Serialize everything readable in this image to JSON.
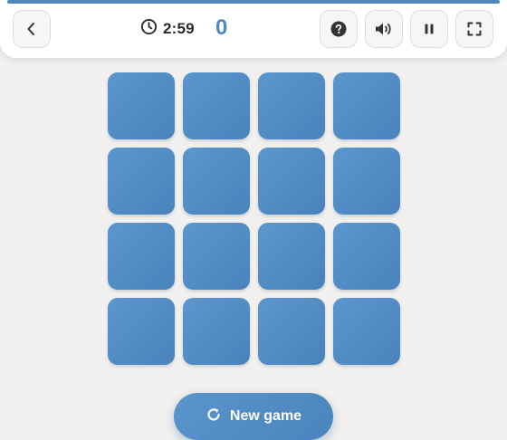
{
  "header": {
    "timer": "2:59",
    "score": "0"
  },
  "board": {
    "rows": 4,
    "columns": 4,
    "cards": [
      {
        "state": "face-down"
      },
      {
        "state": "face-down"
      },
      {
        "state": "face-down"
      },
      {
        "state": "face-down"
      },
      {
        "state": "face-down"
      },
      {
        "state": "face-down"
      },
      {
        "state": "face-down"
      },
      {
        "state": "face-down"
      },
      {
        "state": "face-down"
      },
      {
        "state": "face-down"
      },
      {
        "state": "face-down"
      },
      {
        "state": "face-down"
      },
      {
        "state": "face-down"
      },
      {
        "state": "face-down"
      },
      {
        "state": "face-down"
      },
      {
        "state": "face-down"
      }
    ]
  },
  "actions": {
    "new_game_label": "New game"
  },
  "icons": {
    "back": "chevron-left-icon",
    "timer": "clock-icon",
    "help": "help-icon",
    "sound": "volume-icon",
    "pause": "pause-icon",
    "fullscreen": "fullscreen-icon",
    "new_game": "refresh-icon"
  },
  "colors": {
    "accent": "#4f88c0",
    "card": "#5690c8",
    "background": "#f1f0ee",
    "toolbar": "#ffffff"
  }
}
